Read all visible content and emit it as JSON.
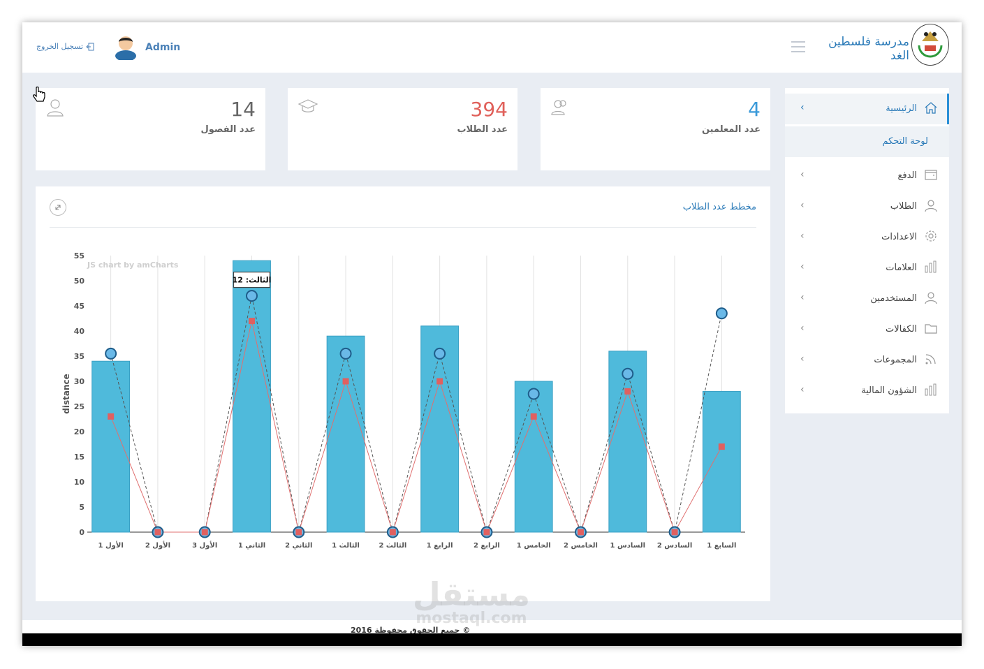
{
  "header": {
    "logout_label": "تسجيل الخروج",
    "user_name": "Admin",
    "school_name": "مدرسة فلسطين الغد"
  },
  "stats": [
    {
      "value": "4",
      "label": "عدد المعلمين",
      "color": "#3a9ad9",
      "icon": "users-icon"
    },
    {
      "value": "394",
      "label": "عدد الطلاب",
      "color": "#e0605a",
      "icon": "graduation-cap-icon"
    },
    {
      "value": "14",
      "label": "عدد الفصول",
      "color": "#666666",
      "icon": "user-icon"
    }
  ],
  "sidebar": {
    "items": [
      {
        "label": "الرئيسية",
        "icon": "home-icon",
        "active": true
      },
      {
        "label": "لوحة التحكم",
        "sub": true
      },
      {
        "label": "الدفع",
        "icon": "wallet-icon"
      },
      {
        "label": "الطلاب",
        "icon": "user-icon"
      },
      {
        "label": "الاعدادات",
        "icon": "gear-icon"
      },
      {
        "label": "العلامات",
        "icon": "bar-chart-icon"
      },
      {
        "label": "المستخدمين",
        "icon": "users-icon"
      },
      {
        "label": "الكفالات",
        "icon": "folder-icon"
      },
      {
        "label": "المجموعات",
        "icon": "rss-icon"
      },
      {
        "label": "الشؤون المالية",
        "icon": "bar-chart-icon"
      }
    ]
  },
  "panel": {
    "title": "مخطط عدد الطلاب"
  },
  "chart_data": {
    "type": "bar",
    "categories": [
      "الأول 1",
      "الأول 2",
      "الأول 3",
      "الثاني 1",
      "الثاني 2",
      "الثالث 1",
      "الثالث 2",
      "الرابع 1",
      "الرابع 2",
      "الخامس 1",
      "الخامس 2",
      "السادس 1",
      "السادس 2",
      "السابع 1"
    ],
    "ylabel": "distance",
    "ylim": [
      0,
      55
    ],
    "yticks": [
      0,
      5,
      10,
      15,
      20,
      25,
      30,
      35,
      40,
      45,
      50,
      55
    ],
    "watermark": "JS chart by amCharts",
    "tooltip": "الثالث: 12",
    "colors": {
      "bars": "#4fbadb",
      "circles": "#6ab9e8",
      "squares": "#e06060"
    },
    "series": [
      {
        "type": "bar",
        "values": [
          34,
          0,
          0,
          54,
          0,
          39,
          0,
          41,
          0,
          30,
          0,
          36,
          0,
          28
        ]
      },
      {
        "type": "line-circle",
        "values": [
          35.5,
          0,
          0,
          47,
          0,
          35.5,
          0,
          35.5,
          0,
          27.5,
          0,
          31.5,
          0,
          43.5
        ]
      },
      {
        "type": "line-square",
        "values": [
          23,
          0,
          0,
          42,
          0,
          30,
          0,
          30,
          0,
          23,
          0,
          28,
          0,
          17
        ]
      }
    ]
  },
  "footer": {
    "text": "جميع الحقوق محفوظة 2016 ©"
  },
  "watermark": {
    "arabic": "مستقل",
    "latin": "mostaql.com"
  }
}
